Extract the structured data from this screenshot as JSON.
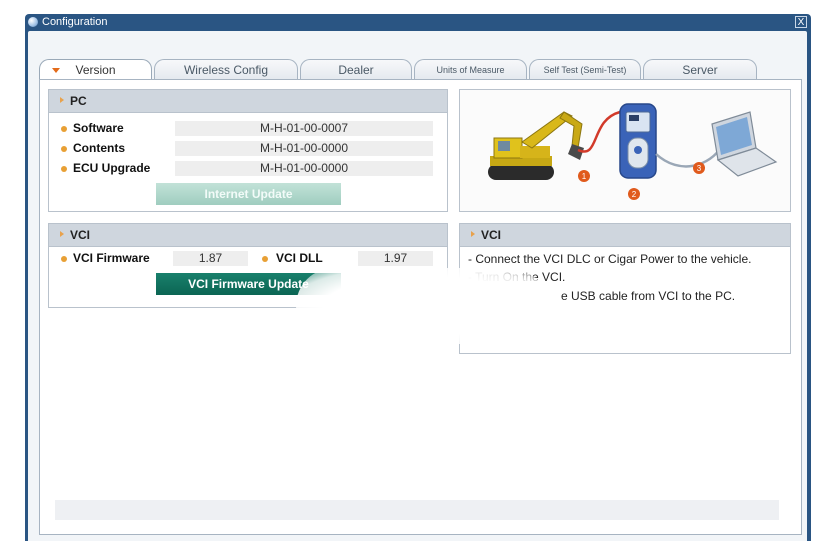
{
  "window": {
    "title": "Configuration",
    "close_glyph": "X"
  },
  "tabs": [
    {
      "label": "Version",
      "active": true
    },
    {
      "label": "Wireless Config",
      "active": false
    },
    {
      "label": "Dealer",
      "active": false
    },
    {
      "label": "Units of Measure",
      "active": false
    },
    {
      "label": "Self Test (Semi-Test)",
      "active": false
    },
    {
      "label": "Server",
      "active": false
    }
  ],
  "pc_panel": {
    "title": "PC",
    "rows": [
      {
        "label": "Software",
        "value": "M-H-01-00-0007"
      },
      {
        "label": "Contents",
        "value": "M-H-01-00-0000"
      },
      {
        "label": "ECU Upgrade",
        "value": "M-H-01-00-0000"
      }
    ],
    "internet_update_label": "Internet Update"
  },
  "vci_panel": {
    "title": "VCI",
    "firmware_label": "VCI Firmware",
    "firmware_value": "1.87",
    "dll_label": "VCI DLL",
    "dll_value": "1.97",
    "firmware_update_label": "VCI Firmware Update"
  },
  "vci_info": {
    "title": "VCI",
    "lines": [
      "- Connect the VCI DLC or Cigar Power to the vehicle.",
      "- Turn On the VCI.",
      "e USB cable from VCI to the PC."
    ]
  },
  "diagram": {
    "steps": [
      "1",
      "2",
      "3"
    ],
    "icons": [
      "excavator-icon",
      "vci-device-icon",
      "laptop-icon"
    ]
  },
  "colors": {
    "frame": "#2a5583",
    "accent": "#e8a035",
    "button_teal": "#0b6553",
    "step_badge": "#e05a1c"
  }
}
